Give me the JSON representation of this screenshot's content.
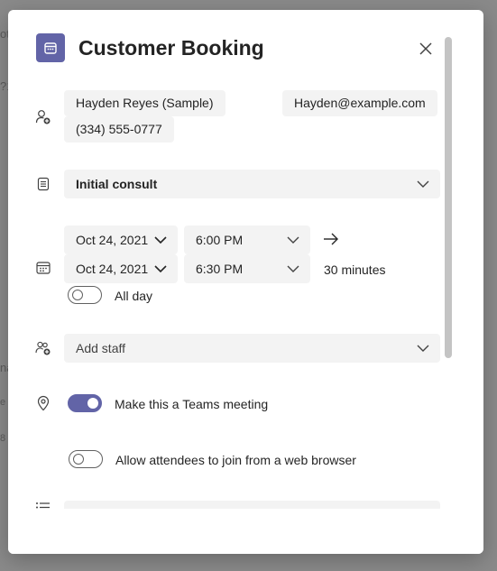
{
  "backdrop": {
    "fragments": [
      "ot",
      "?1",
      "na",
      "e",
      "8"
    ]
  },
  "dialog": {
    "title": "Customer Booking",
    "accent_color": "#6264a7"
  },
  "customer": {
    "name": "Hayden Reyes (Sample)",
    "email": "Hayden@example.com",
    "phone": "(334) 555-0777"
  },
  "service": {
    "selected": "Initial consult"
  },
  "schedule": {
    "start_date": "Oct 24, 2021",
    "start_time": "6:00 PM",
    "end_date": "Oct 24, 2021",
    "end_time": "6:30 PM",
    "duration": "30 minutes",
    "all_day_label": "All day",
    "all_day_on": false
  },
  "staff": {
    "placeholder": "Add staff"
  },
  "meeting": {
    "teams_label": "Make this a Teams meeting",
    "teams_on": true,
    "web_label": "Allow attendees to join from a web browser",
    "web_on": false
  },
  "icons": {
    "app": "calendar-icon",
    "close": "close-icon",
    "customer": "person-add-icon",
    "service": "notes-icon",
    "schedule": "calendar-icon",
    "staff": "people-add-icon",
    "location": "location-icon",
    "notes": "list-icon",
    "arrow": "arrow-right-icon",
    "chevron": "chevron-down-icon"
  }
}
